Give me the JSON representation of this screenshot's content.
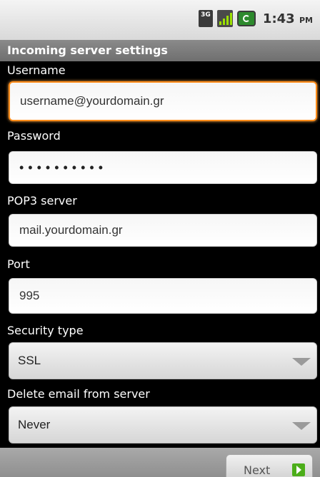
{
  "status_bar": {
    "network_label": "3G",
    "time": "1:43",
    "ampm": "PM"
  },
  "title": "Incoming server settings",
  "fields": {
    "username": {
      "label": "Username",
      "value": "username@yourdomain.gr"
    },
    "password": {
      "label": "Password",
      "value": "••••••••••"
    },
    "pop3_server": {
      "label": "POP3 server",
      "value": "mail.yourdomain.gr"
    },
    "port": {
      "label": "Port",
      "value": "995"
    },
    "security_type": {
      "label": "Security type",
      "selected": "SSL"
    },
    "delete_email": {
      "label": "Delete email from server",
      "selected": "Never"
    }
  },
  "buttons": {
    "next_label": "Next"
  },
  "colors": {
    "focus_border": "#ff8c1a",
    "next_icon": "#4cae1a"
  }
}
